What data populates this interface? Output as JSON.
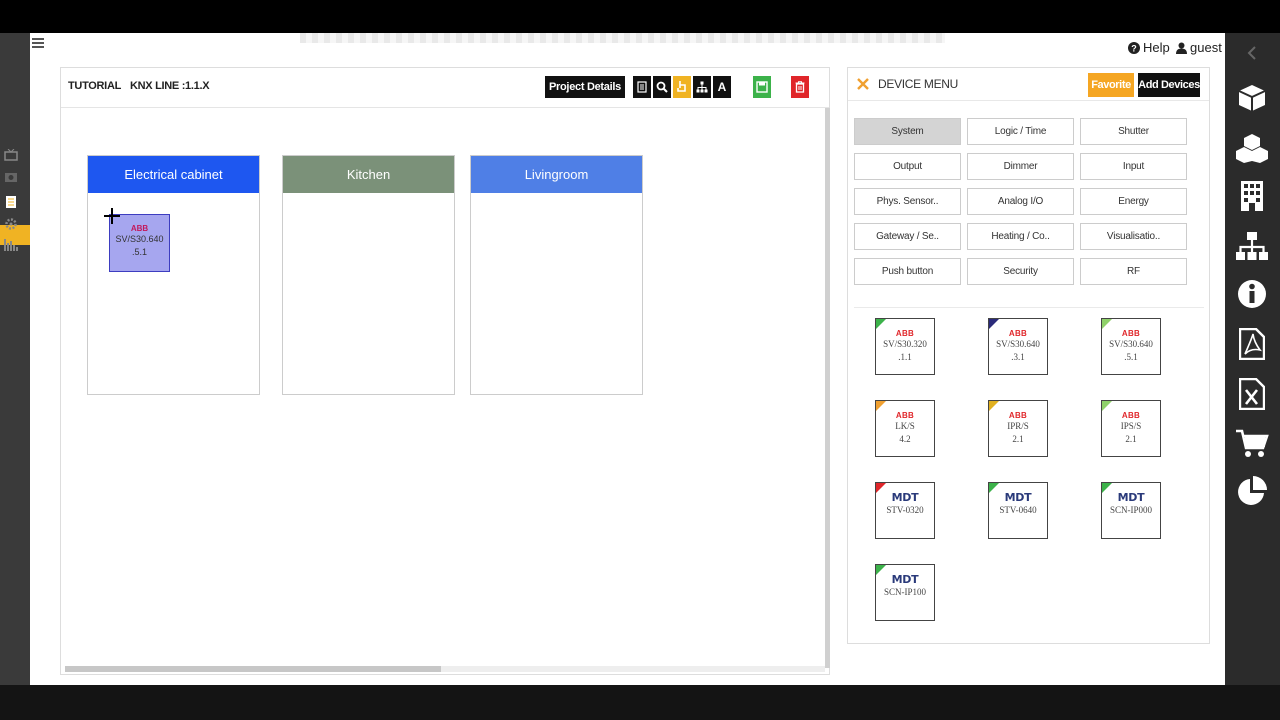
{
  "header": {
    "help_label": "Help",
    "user_label": "guest"
  },
  "toolbar": {
    "project_name": "TUTORIAL",
    "line_label": "KNX LINE :1.1.X",
    "project_details_label": "Project Details",
    "tools": [
      "document-icon",
      "search-icon",
      "hand-pointer-icon",
      "sitemap-icon",
      "font-icon",
      "save-icon",
      "delete-icon"
    ],
    "text_tool_label": "A"
  },
  "rooms": [
    {
      "name": "Electrical cabinet",
      "color": "#1e57f0"
    },
    {
      "name": "Kitchen",
      "color": "#7b9179"
    },
    {
      "name": "Livingroom",
      "color": "#4f7fe6"
    }
  ],
  "placed_device": {
    "brand": "ABB",
    "model_line1": "SV/S30.640",
    "model_line2": ".5.1"
  },
  "device_menu": {
    "title": "DEVICE MENU",
    "favorite_label": "Favorite",
    "add_devices_label": "Add Devices",
    "categories": [
      "System",
      "Logic / Time",
      "Shutter",
      "Output",
      "Dimmer",
      "Input",
      "Phys. Sensor..",
      "Analog I/O",
      "Energy",
      "Gateway / Se..",
      "Heating / Co..",
      "Visualisatio..",
      "Push button",
      "Security",
      "RF"
    ],
    "selected_category": "System",
    "devices": [
      {
        "brand": "ABB",
        "line1": "SV/S30.320",
        "line2": ".1.1",
        "corner": "#3cb24a"
      },
      {
        "brand": "ABB",
        "line1": "SV/S30.640",
        "line2": ".3.1",
        "corner": "#2a2a7a"
      },
      {
        "brand": "ABB",
        "line1": "SV/S30.640",
        "line2": ".5.1",
        "corner": "#8fd16a"
      },
      {
        "brand": "ABB",
        "line1": "LK/S",
        "line2": "4.2",
        "corner": "#f0a030"
      },
      {
        "brand": "ABB",
        "line1": "IPR/S",
        "line2": "2.1",
        "corner": "#e0b020"
      },
      {
        "brand": "ABB",
        "line1": "IPS/S",
        "line2": "2.1",
        "corner": "#8fd16a"
      },
      {
        "brand": "MDT",
        "line1": "STV-0320",
        "line2": "",
        "corner": "#e0262a"
      },
      {
        "brand": "MDT",
        "line1": "STV-0640",
        "line2": "",
        "corner": "#3cb24a"
      },
      {
        "brand": "MDT",
        "line1": "SCN-IP000",
        "line2": "",
        "corner": "#3cb24a"
      },
      {
        "brand": "MDT",
        "line1": "SCN-IP100",
        "line2": "",
        "corner": "#3cb24a"
      }
    ]
  },
  "right_rail_icons": [
    "cube-icon",
    "cubes-icon",
    "building-icon",
    "sitemap-icon",
    "info-icon",
    "pdf-file-icon",
    "excel-file-icon",
    "cart-icon",
    "pie-chart-icon"
  ],
  "left_rail_icons": [
    "tv-icon",
    "camera-icon",
    "document-icon",
    "gear-icon",
    "bar-chart-icon"
  ]
}
